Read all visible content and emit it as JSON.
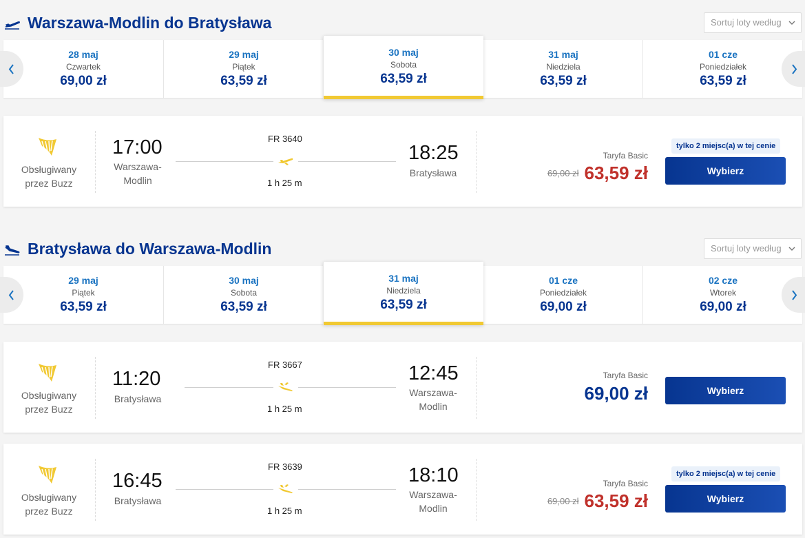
{
  "outbound": {
    "title": "Warszawa-Modlin do Bratysława",
    "sort_label": "Sortuj loty według",
    "dates": [
      {
        "date": "28 maj",
        "day": "Czwartek",
        "price": "69,00 zł"
      },
      {
        "date": "29 maj",
        "day": "Piątek",
        "price": "63,59 zł"
      },
      {
        "date": "30 maj",
        "day": "Sobota",
        "price": "63,59 zł"
      },
      {
        "date": "31 maj",
        "day": "Niedziela",
        "price": "63,59 zł"
      },
      {
        "date": "01 cze",
        "day": "Poniedziałek",
        "price": "63,59 zł"
      }
    ],
    "selected_index": 2,
    "flights": [
      {
        "operated": "Obsługiwany przez Buzz",
        "dep_time": "17:00",
        "dep_city": "Warszawa-Modlin",
        "flight_no": "FR 3640",
        "duration": "1 h 25 m",
        "arr_time": "18:25",
        "arr_city": "Bratysława",
        "tariff": "Taryfa Basic",
        "old_price": "69,00 zł",
        "price": "63,59 zł",
        "badge": "tylko 2 miejsc(a) w tej cenie",
        "button": "Wybierz"
      }
    ]
  },
  "return": {
    "title": "Bratysława do Warszawa-Modlin",
    "sort_label": "Sortuj loty według",
    "dates": [
      {
        "date": "29 maj",
        "day": "Piątek",
        "price": "63,59 zł"
      },
      {
        "date": "30 maj",
        "day": "Sobota",
        "price": "63,59 zł"
      },
      {
        "date": "31 maj",
        "day": "Niedziela",
        "price": "63,59 zł"
      },
      {
        "date": "01 cze",
        "day": "Poniedziałek",
        "price": "69,00 zł"
      },
      {
        "date": "02 cze",
        "day": "Wtorek",
        "price": "69,00 zł"
      }
    ],
    "selected_index": 2,
    "flights": [
      {
        "operated": "Obsługiwany przez Buzz",
        "dep_time": "11:20",
        "dep_city": "Bratysława",
        "flight_no": "FR 3667",
        "duration": "1 h 25 m",
        "arr_time": "12:45",
        "arr_city": "Warszawa-Modlin",
        "tariff": "Taryfa Basic",
        "price": "69,00 zł",
        "button": "Wybierz"
      },
      {
        "operated": "Obsługiwany przez Buzz",
        "dep_time": "16:45",
        "dep_city": "Bratysława",
        "flight_no": "FR 3639",
        "duration": "1 h 25 m",
        "arr_time": "18:10",
        "arr_city": "Warszawa-Modlin",
        "tariff": "Taryfa Basic",
        "old_price": "69,00 zł",
        "price": "63,59 zł",
        "badge": "tylko 2 miejsc(a) w tej cenie",
        "button": "Wybierz"
      }
    ]
  },
  "colors": {
    "brand_blue": "#073590",
    "accent_yellow": "#f1c933",
    "price_red": "#c0312b",
    "link_blue": "#1a73c1"
  },
  "icons": [
    "plane-takeoff-icon",
    "plane-landing-icon",
    "ryanair-harp-logo",
    "plane-icon",
    "chevron-left-icon",
    "chevron-right-icon",
    "chevron-down-icon"
  ]
}
